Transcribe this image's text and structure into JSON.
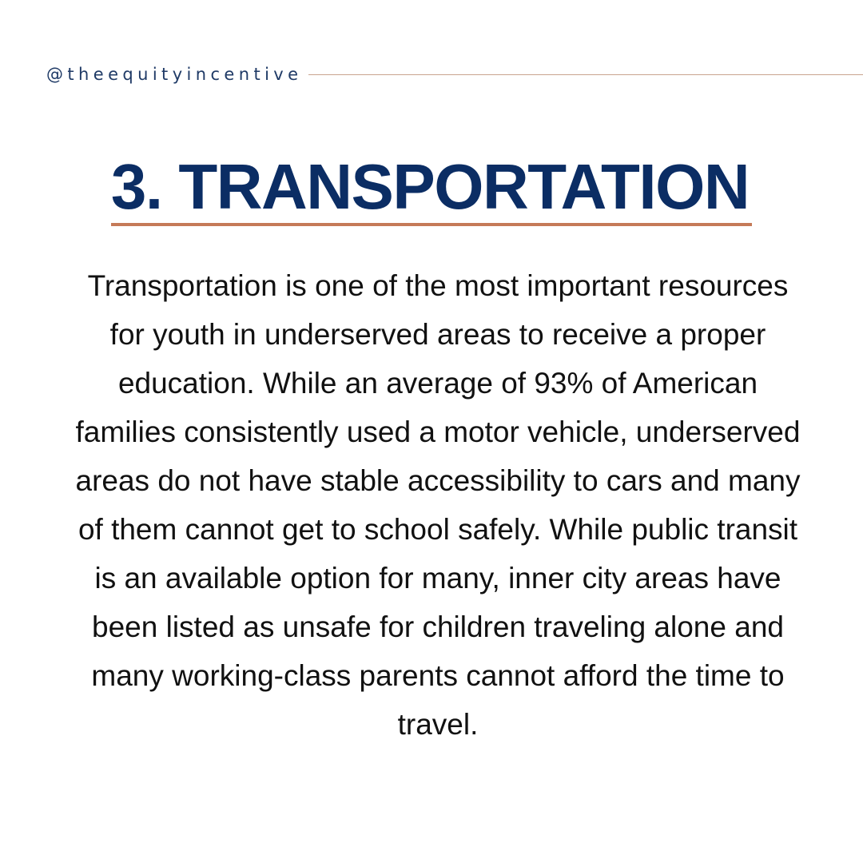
{
  "header": {
    "handle": "@theequityincentive"
  },
  "section": {
    "title": "3. TRANSPORTATION",
    "paragraph": "Transportation is one of the most important resources for youth in underserved areas to receive a proper education. While an average of 93% of American families consistently used a motor vehicle, underserved areas do not have stable accessibility to cars and many of them cannot get to school safely. While public transit is an available option for many, inner city areas have been listed as unsafe for children traveling alone and many working-class parents cannot afford the time to travel."
  },
  "colors": {
    "title": "#0b2d64",
    "handle": "#1f3a66",
    "accent_rule": "#c57a58",
    "header_line": "#c9a48e",
    "body_text": "#111111",
    "background": "#ffffff"
  }
}
